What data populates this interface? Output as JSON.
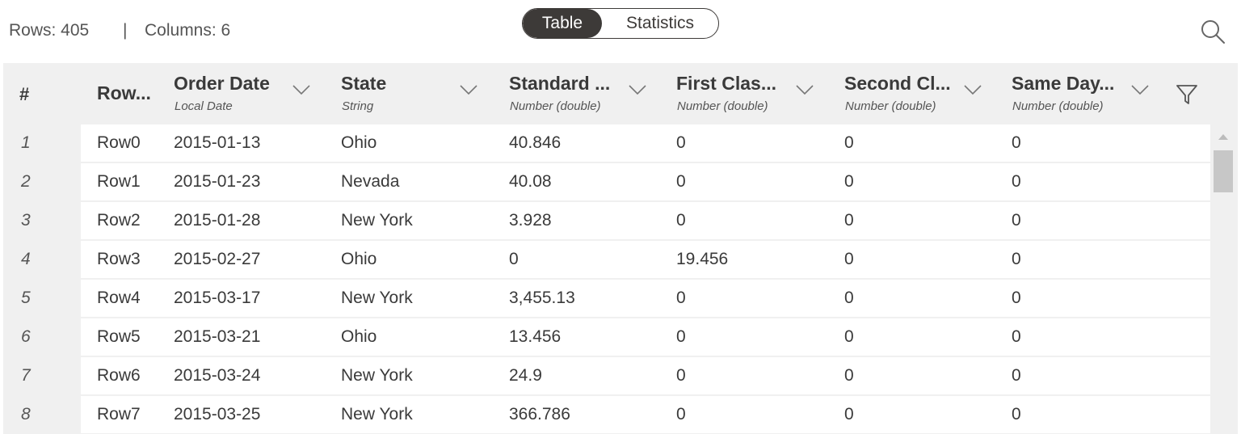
{
  "summary": {
    "rows_label": "Rows: 405",
    "separator": "|",
    "columns_label": "Columns: 6"
  },
  "view_toggle": {
    "options": [
      "Table",
      "Statistics"
    ],
    "selected": "Table"
  },
  "icons": {
    "search": "search-icon",
    "filter": "filter-icon",
    "sort": "chevron-down-icon"
  },
  "table": {
    "index_header": "#",
    "columns": [
      {
        "title": "Row...",
        "type": ""
      },
      {
        "title": "Order Date",
        "type": "Local Date"
      },
      {
        "title": "State",
        "type": "String"
      },
      {
        "title": "Standard ...",
        "type": "Number (double)"
      },
      {
        "title": "First Clas...",
        "type": "Number (double)"
      },
      {
        "title": "Second Cl...",
        "type": "Number (double)"
      },
      {
        "title": "Same Day...",
        "type": "Number (double)"
      }
    ],
    "rows": [
      {
        "index": "1",
        "cells": [
          "Row0",
          "2015-01-13",
          "Ohio",
          "40.846",
          "0",
          "0",
          "0"
        ]
      },
      {
        "index": "2",
        "cells": [
          "Row1",
          "2015-01-23",
          "Nevada",
          "40.08",
          "0",
          "0",
          "0"
        ]
      },
      {
        "index": "3",
        "cells": [
          "Row2",
          "2015-01-28",
          "New York",
          "3.928",
          "0",
          "0",
          "0"
        ]
      },
      {
        "index": "4",
        "cells": [
          "Row3",
          "2015-02-27",
          "Ohio",
          "0",
          "19.456",
          "0",
          "0"
        ]
      },
      {
        "index": "5",
        "cells": [
          "Row4",
          "2015-03-17",
          "New York",
          "3,455.13",
          "0",
          "0",
          "0"
        ]
      },
      {
        "index": "6",
        "cells": [
          "Row5",
          "2015-03-21",
          "Ohio",
          "13.456",
          "0",
          "0",
          "0"
        ]
      },
      {
        "index": "7",
        "cells": [
          "Row6",
          "2015-03-24",
          "New York",
          "24.9",
          "0",
          "0",
          "0"
        ]
      },
      {
        "index": "8",
        "cells": [
          "Row7",
          "2015-03-25",
          "New York",
          "366.786",
          "0",
          "0",
          "0"
        ]
      }
    ]
  }
}
